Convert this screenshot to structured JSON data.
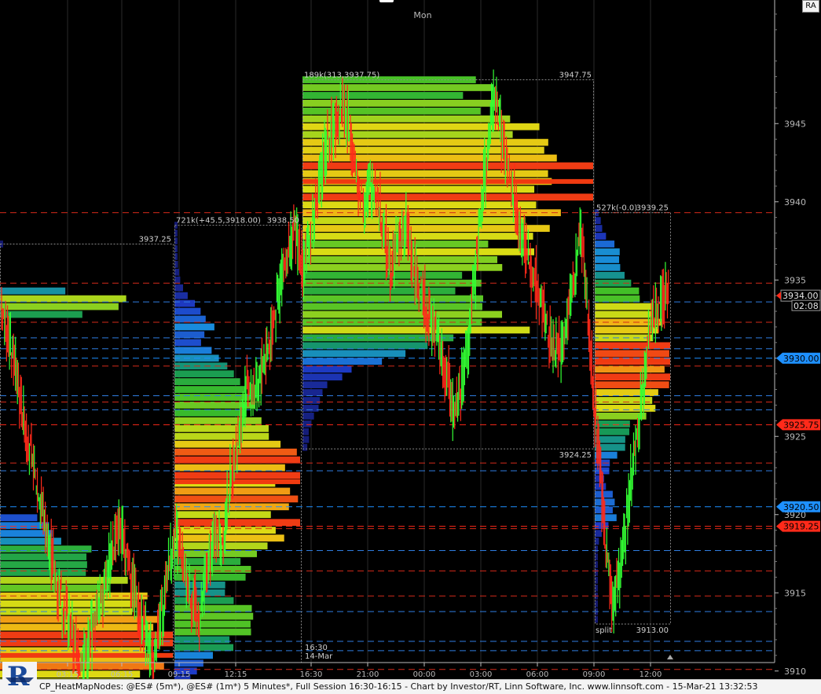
{
  "chart_data": {
    "type": "line",
    "title": "",
    "day_label": "Mon",
    "y_axis": {
      "ylim": [
        3908.5,
        3952.5
      ],
      "ticks": [
        3910,
        3915,
        3920,
        3925,
        3930,
        3935,
        3940,
        3945
      ],
      "tick_labels": [
        "3910",
        "3915",
        "3920",
        "3925",
        "3930",
        "3935",
        "3940",
        "3945"
      ]
    },
    "x_axis": {
      "tick_labels": [
        "03:15",
        "06:15",
        "09:15",
        "12:15",
        "16:30",
        "21:00",
        "00:00",
        "03:00",
        "06:00",
        "09:00",
        "12:00"
      ]
    },
    "session_marker": {
      "time": "16:30",
      "date": "14-Mar"
    },
    "price_levels": [
      {
        "price": 3934.0,
        "label": "3934.00",
        "color": "#ff2a1a",
        "kind": "last"
      },
      {
        "price": 3930.0,
        "label": "3930.00",
        "color": "#1e90ff",
        "kind": "blue"
      },
      {
        "price": 3925.75,
        "label": "3925.75",
        "color": "#ff2a1a",
        "kind": "red"
      },
      {
        "price": 3920.5,
        "label": "3920.50",
        "color": "#1e90ff",
        "kind": "blue"
      },
      {
        "price": 3919.25,
        "label": "3919.25",
        "color": "#ff2a1a",
        "kind": "red"
      }
    ],
    "countdown": "02:08",
    "reference_lines": {
      "red": [
        3939.3,
        3934.8,
        3932.3,
        3929.5,
        3927.2,
        3923.3,
        3919.1,
        3916.4,
        3914.8,
        3910.1
      ],
      "blue": [
        3933.6,
        3931.3,
        3930.6,
        3927.6,
        3926.7,
        3922.8,
        3917.7,
        3913.8,
        3911.9,
        3911.3
      ]
    },
    "profiles": [
      {
        "id": "p1",
        "header_left": "",
        "header_right": "3937.25",
        "footer_left": "",
        "footer_right": "",
        "range": [
          3909.0,
          3937.3
        ],
        "poc": 3911.0
      },
      {
        "id": "p2",
        "header_left": "721k(+45.5,3918.00)",
        "header_right": "3938.50",
        "footer_left": "",
        "footer_right": "",
        "range": [
          3909.0,
          3938.5
        ],
        "poc": 3922.1
      },
      {
        "id": "p3",
        "header_left": "189k(313,3937.75)",
        "header_right": "3947.75",
        "footer_left": "",
        "footer_right": "3924.25",
        "range": [
          3924.2,
          3947.8
        ],
        "poc": 3941.3
      },
      {
        "id": "p4",
        "header_left": "527k(-0.0)",
        "header_right": "3939.25",
        "footer_left": "split",
        "footer_right": "3913.00",
        "range": [
          3913.0,
          3939.3
        ],
        "poc": 3929.9
      }
    ],
    "series": [
      {
        "name": "",
        "values": [
          3933.2,
          3931.4,
          3929.0,
          3925.6,
          3923.2,
          3920.9,
          3918.2,
          3915.7,
          3914.0,
          3912.1,
          3910.5,
          3911.7,
          3913.6,
          3915.5,
          3917.9,
          3919.0,
          3917.1,
          3914.7,
          3912.7,
          3910.7,
          3912.8,
          3916.6,
          3918.6,
          3916.2,
          3914.7,
          3912.9,
          3916.6,
          3919.1,
          3918.5,
          3922.5,
          3925.4,
          3928.2,
          3927.6,
          3929.6,
          3931.4,
          3934.5,
          3936.4,
          3938.0,
          3935.9,
          3937.9,
          3941.0,
          3943.8,
          3944.9,
          3946.2,
          3944.2,
          3940.5,
          3940.3,
          3941.3,
          3938.3,
          3935.8,
          3937.6,
          3938.3,
          3935.5,
          3933.9,
          3932.6,
          3931.5,
          3929.0,
          3926.6,
          3928.6,
          3932.2,
          3937.6,
          3942.2,
          3946.9,
          3944.2,
          3941.3,
          3939.1,
          3936.9,
          3935.2,
          3933.7,
          3931.3,
          3930.3,
          3932.0,
          3935.0,
          3938.4,
          3931.4,
          3924.5,
          3918.7,
          3914.0,
          3916.9,
          3921.0,
          3925.2,
          3929.4,
          3932.7,
          3933.7,
          3934.0
        ]
      }
    ]
  },
  "ui": {
    "ra_label": "RA",
    "footer": "CP_HeatMapNodes: @ES# (5m*), @ES# (1m*) 5 Minutes*, Full Session 16:30-16:15 - Chart by Investor/RT, Linn Software, Inc. www.linnsoft.com - 15-Mar-21 13:32:53"
  },
  "colors": {
    "background": "#000000",
    "grid": "#2a2a2a",
    "up_bar": "#33ff33",
    "down_bar": "#ff2a1a",
    "red_line": "#d42a1a",
    "blue_line": "#2f7de0",
    "axis_text": "#b8b8b8",
    "box_border": "#8a8a8a"
  }
}
